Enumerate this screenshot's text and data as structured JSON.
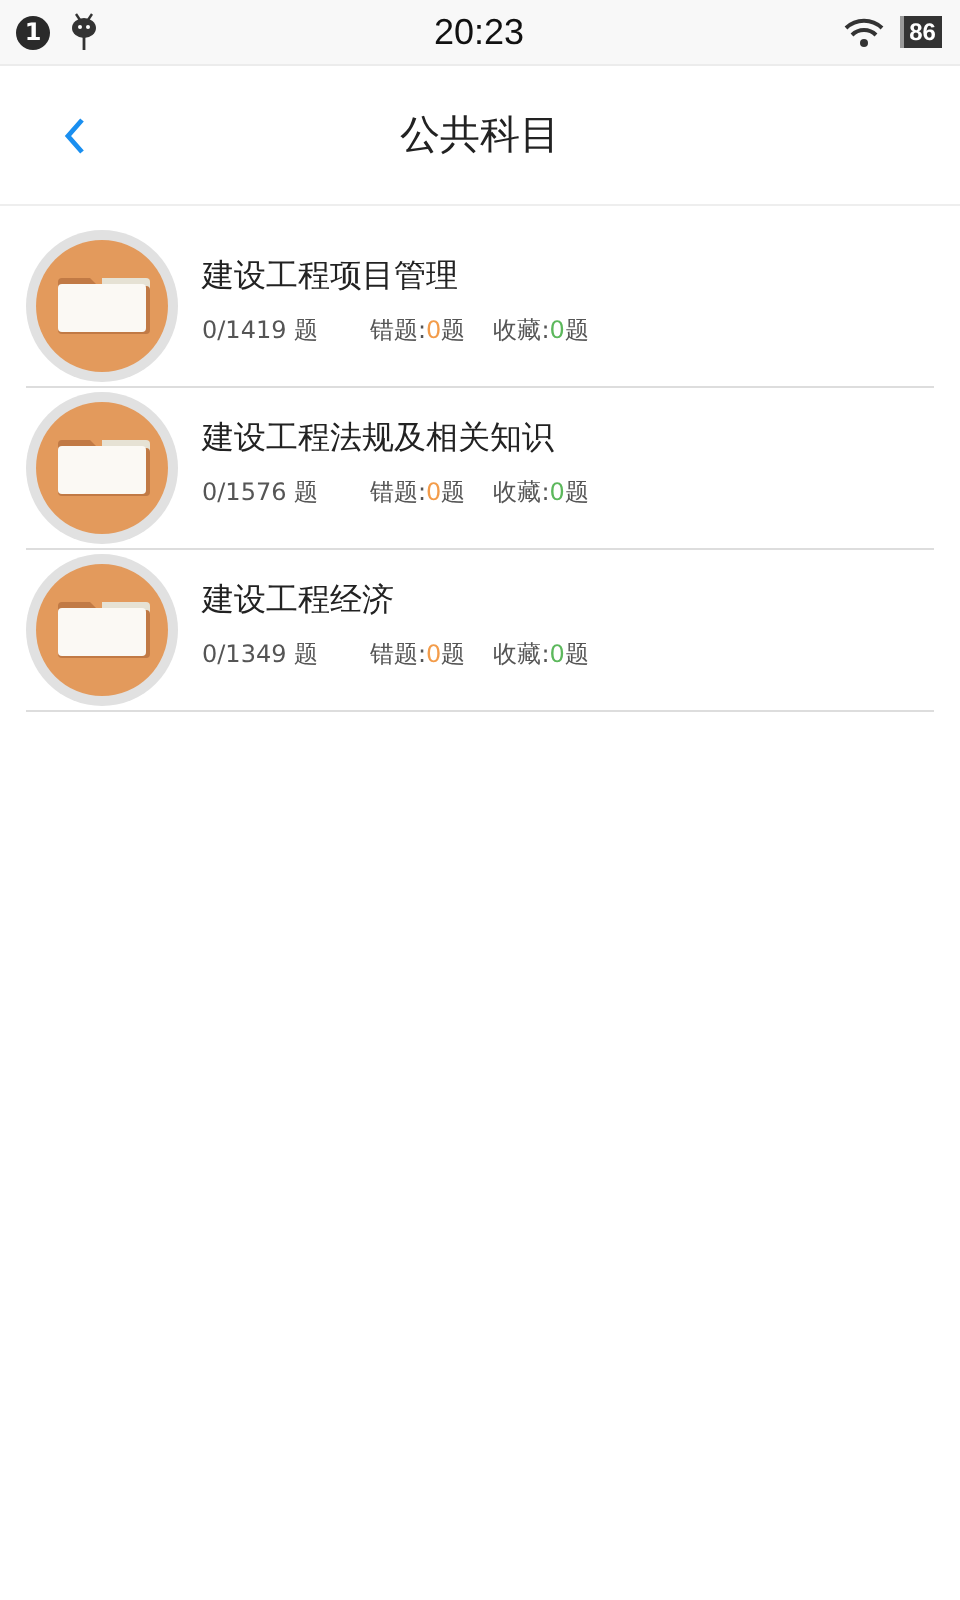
{
  "status_bar": {
    "notification_count": "1",
    "time": "20:23",
    "battery": "86"
  },
  "header": {
    "title": "公共科目"
  },
  "subjects": [
    {
      "title": "建设工程项目管理",
      "progress": "0/1419 题",
      "wrong_label": "错题:",
      "wrong_count": "0",
      "wrong_unit": "题",
      "fav_label": "收藏:",
      "fav_count": "0",
      "fav_unit": "题"
    },
    {
      "title": "建设工程法规及相关知识",
      "progress": "0/1576 题",
      "wrong_label": "错题:",
      "wrong_count": "0",
      "wrong_unit": "题",
      "fav_label": "收藏:",
      "fav_count": "0",
      "fav_unit": "题"
    },
    {
      "title": "建设工程经济",
      "progress": "0/1349 题",
      "wrong_label": "错题:",
      "wrong_count": "0",
      "wrong_unit": "题",
      "fav_label": "收藏:",
      "fav_count": "0",
      "fav_unit": "题"
    }
  ]
}
